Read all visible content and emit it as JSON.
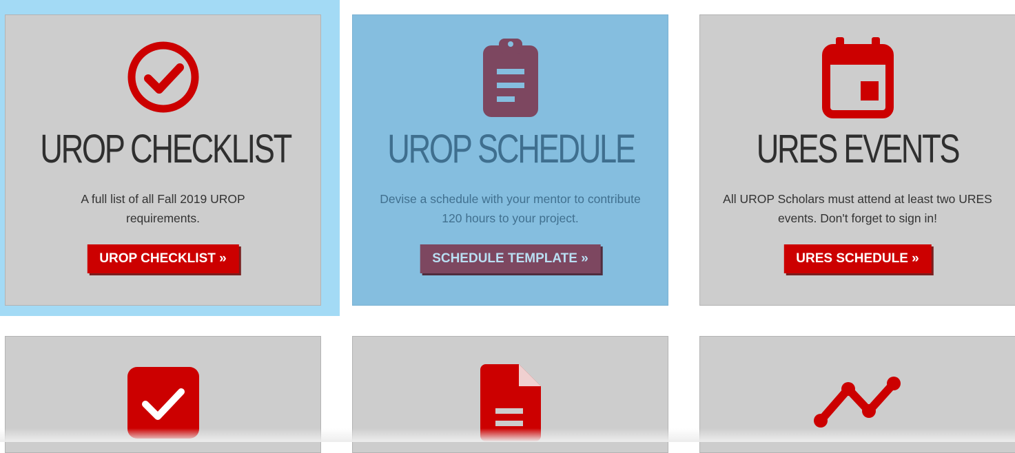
{
  "cards": [
    {
      "icon": "check-circle-icon",
      "title": "UROP CHECKLIST",
      "description": "A full list of all Fall 2019 UROP requirements.",
      "button": "UROP CHECKLIST »"
    },
    {
      "icon": "clipboard-icon",
      "title": "UROP SCHEDULE",
      "description": "Devise a schedule with your mentor to contribute 120 hours to your project.",
      "button": "SCHEDULE TEMPLATE »"
    },
    {
      "icon": "calendar-icon",
      "title": "URES EVENTS",
      "description": "All UROP Scholars must attend at least two URES events. Don't forget to sign in!",
      "button": "URES SCHEDULE »"
    },
    {
      "icon": "check-square-icon"
    },
    {
      "icon": "document-icon"
    },
    {
      "icon": "line-graph-icon"
    }
  ],
  "colors": {
    "accent": "#cc0000",
    "card_bg": "#cdcdcd",
    "highlight_bg": "#85bedf",
    "highlight_ring": "#a3daf5",
    "highlight_accent": "#7d4760"
  }
}
